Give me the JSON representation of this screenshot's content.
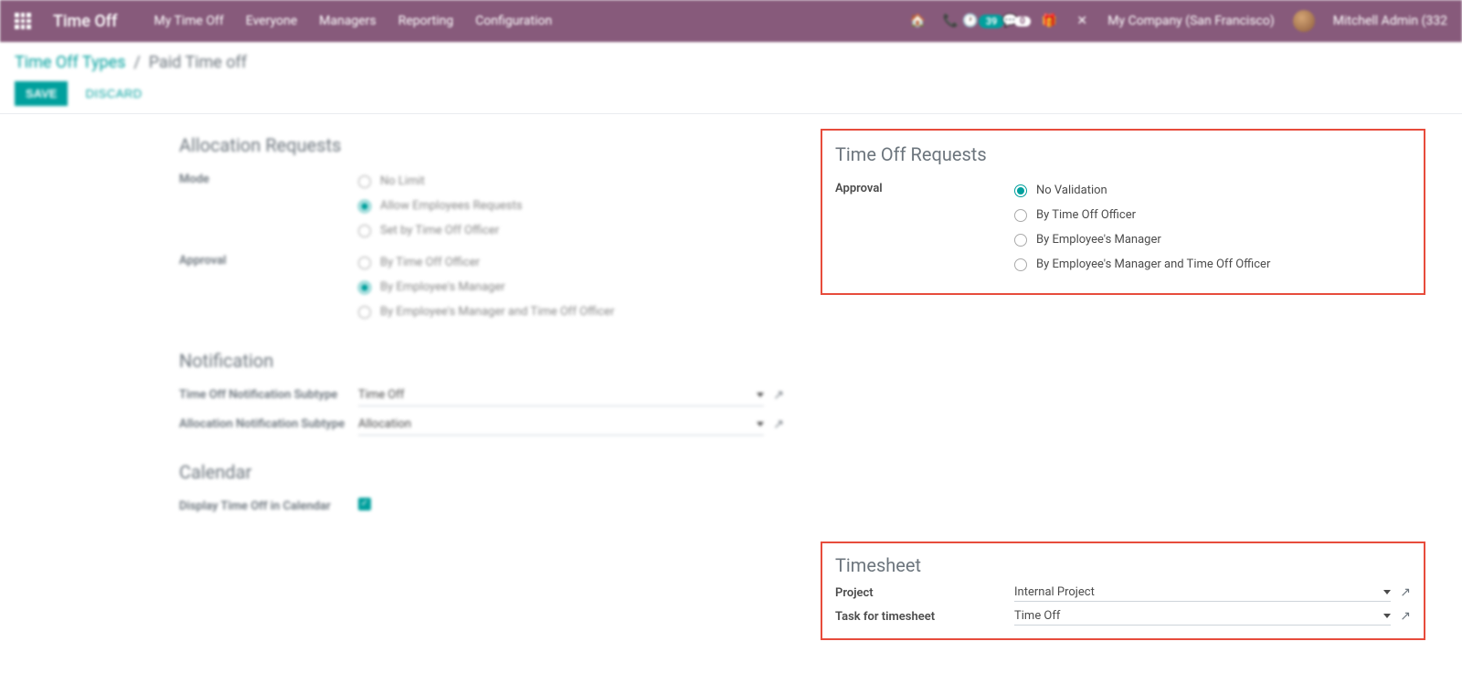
{
  "navbar": {
    "brand": "Time Off",
    "menu": [
      "My Time Off",
      "Everyone",
      "Managers",
      "Reporting",
      "Configuration"
    ],
    "activity_badge": "39",
    "discuss_badge": "0",
    "company": "My Company (San Francisco)",
    "user": "Mitchell Admin (332"
  },
  "breadcrumb": {
    "parent": "Time Off Types",
    "current": "Paid Time off"
  },
  "buttons": {
    "save": "SAVE",
    "discard": "DISCARD"
  },
  "left": {
    "alloc_title": "Allocation Requests",
    "mode_label": "Mode",
    "mode_opts": [
      "No Limit",
      "Allow Employees Requests",
      "Set by Time Off Officer"
    ],
    "approval_label": "Approval",
    "approval_opts": [
      "By Time Off Officer",
      "By Employee's Manager",
      "By Employee's Manager and Time Off Officer"
    ],
    "notif_title": "Notification",
    "notif1_label": "Time Off Notification Subtype",
    "notif1_val": "Time Off",
    "notif2_label": "Allocation Notification Subtype",
    "notif2_val": "Allocation",
    "cal_title": "Calendar",
    "cal_label": "Display Time Off in Calendar"
  },
  "right": {
    "req_title": "Time Off Requests",
    "req_label": "Approval",
    "req_opts": [
      "No Validation",
      "By Time Off Officer",
      "By Employee's Manager",
      "By Employee's Manager and Time Off Officer"
    ],
    "ts_title": "Timesheet",
    "ts_project_label": "Project",
    "ts_project_val": "Internal Project",
    "ts_task_label": "Task for timesheet",
    "ts_task_val": "Time Off"
  }
}
